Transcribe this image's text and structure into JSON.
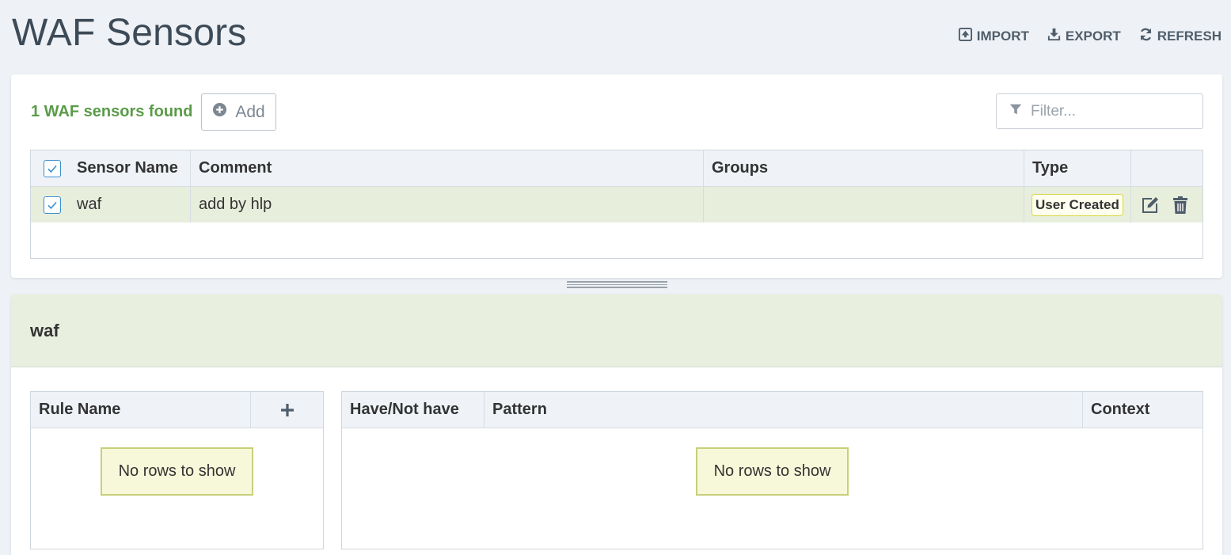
{
  "page": {
    "title": "WAF Sensors"
  },
  "toolbar": {
    "import_label": "IMPORT",
    "export_label": "EXPORT",
    "refresh_label": "REFRESH"
  },
  "sensors": {
    "found_text": "1 WAF sensors found",
    "add_label": "Add",
    "filter_placeholder": "Filter...",
    "columns": [
      "Sensor Name",
      "Comment",
      "Groups",
      "Type"
    ],
    "rows": [
      {
        "name": "waf",
        "comment": "add by hlp",
        "groups": "",
        "type": "User Created",
        "selected": true
      }
    ]
  },
  "detail": {
    "title": "waf",
    "rules": {
      "columns": [
        "Rule Name"
      ],
      "empty_text": "No rows to show"
    },
    "patterns": {
      "columns": [
        "Have/Not have",
        "Pattern",
        "Context"
      ],
      "empty_text": "No rows to show"
    }
  },
  "colors": {
    "accent_green": "#5a9b48",
    "selected_row": "#e8eedc",
    "checkbox_blue": "#3b8fd0",
    "badge_border": "#d8d84a"
  },
  "icons": [
    "import-icon",
    "export-icon",
    "refresh-icon",
    "plus-circle-icon",
    "filter-icon",
    "checkbox-icon",
    "edit-icon",
    "trash-icon",
    "plus-icon"
  ]
}
